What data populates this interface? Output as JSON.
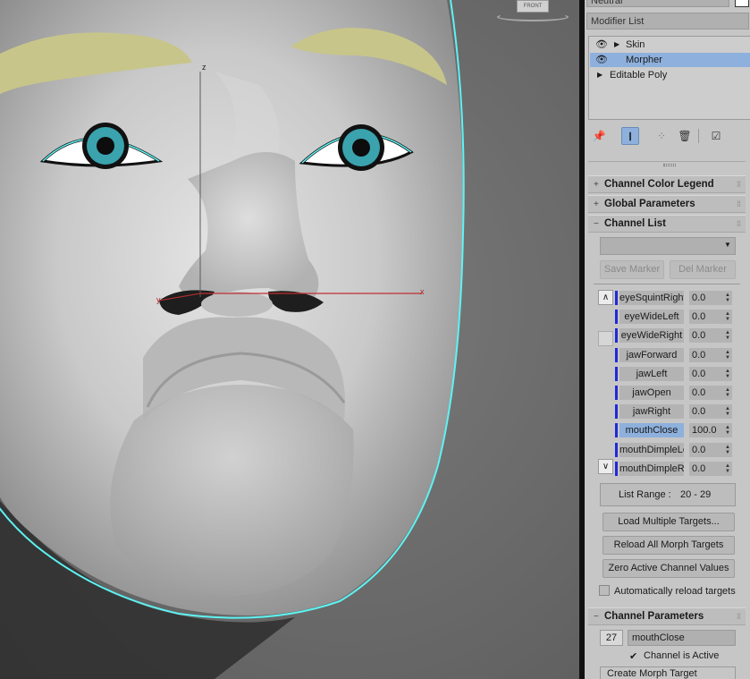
{
  "viewport": {
    "viewcube_label": "FRONT",
    "axis_labels": {
      "z": "z",
      "x": "x",
      "y": "y"
    }
  },
  "panel": {
    "name_field": "Neutral",
    "modifier_list_label": "Modifier List",
    "stack": [
      {
        "label": "Skin",
        "has_eye": true,
        "expand": "▶",
        "selected": false
      },
      {
        "label": "Morpher",
        "has_eye": true,
        "expand": "",
        "selected": true
      },
      {
        "label": "Editable Poly",
        "has_eye": false,
        "expand": "▶",
        "selected": false
      }
    ],
    "toolbar_icons": [
      "pin-stack-icon",
      "show-end-result-icon",
      "make-unique-icon",
      "remove-modifier-icon",
      "configure-sets-icon"
    ],
    "rollouts": {
      "channel_color_legend": "Channel Color Legend",
      "global_parameters": "Global Parameters",
      "channel_list": "Channel List",
      "channel_parameters": "Channel Parameters"
    },
    "channel_list": {
      "marker_dropdown_value": "",
      "save_marker": "Save Marker",
      "del_marker": "Del Marker",
      "channels": [
        {
          "name": "eyeSquintRight",
          "value": "0.0",
          "selected": false
        },
        {
          "name": "eyeWideLeft",
          "value": "0.0",
          "selected": false
        },
        {
          "name": "eyeWideRight",
          "value": "0.0",
          "selected": false
        },
        {
          "name": "jawForward",
          "value": "0.0",
          "selected": false
        },
        {
          "name": "jawLeft",
          "value": "0.0",
          "selected": false
        },
        {
          "name": "jawOpen",
          "value": "0.0",
          "selected": false
        },
        {
          "name": "jawRight",
          "value": "0.0",
          "selected": false
        },
        {
          "name": "mouthClose",
          "value": "100.0",
          "selected": true
        },
        {
          "name": "mouthDimpleLeft",
          "value": "0.0",
          "selected": false
        },
        {
          "name": "mouthDimpleRight",
          "value": "0.0",
          "selected": false
        }
      ],
      "list_range_label": "List Range :",
      "list_range_value": "20 - 29",
      "load_multiple": "Load Multiple Targets...",
      "reload_all": "Reload All Morph Targets",
      "zero_active": "Zero Active Channel Values",
      "auto_reload": "Automatically reload targets",
      "auto_reload_checked": false
    },
    "channel_parameters": {
      "channel_number": "27",
      "channel_name": "mouthClose",
      "channel_is_active": "Channel is Active",
      "channel_is_active_checked": true,
      "create_morph_target": "Create Morph Target"
    }
  },
  "colors": {
    "selection_blue": "#8eb0dc",
    "channel_bar": "#1f2ad6",
    "mesh_outline": "#5ef2f2",
    "iris": "#3aa3ae"
  }
}
